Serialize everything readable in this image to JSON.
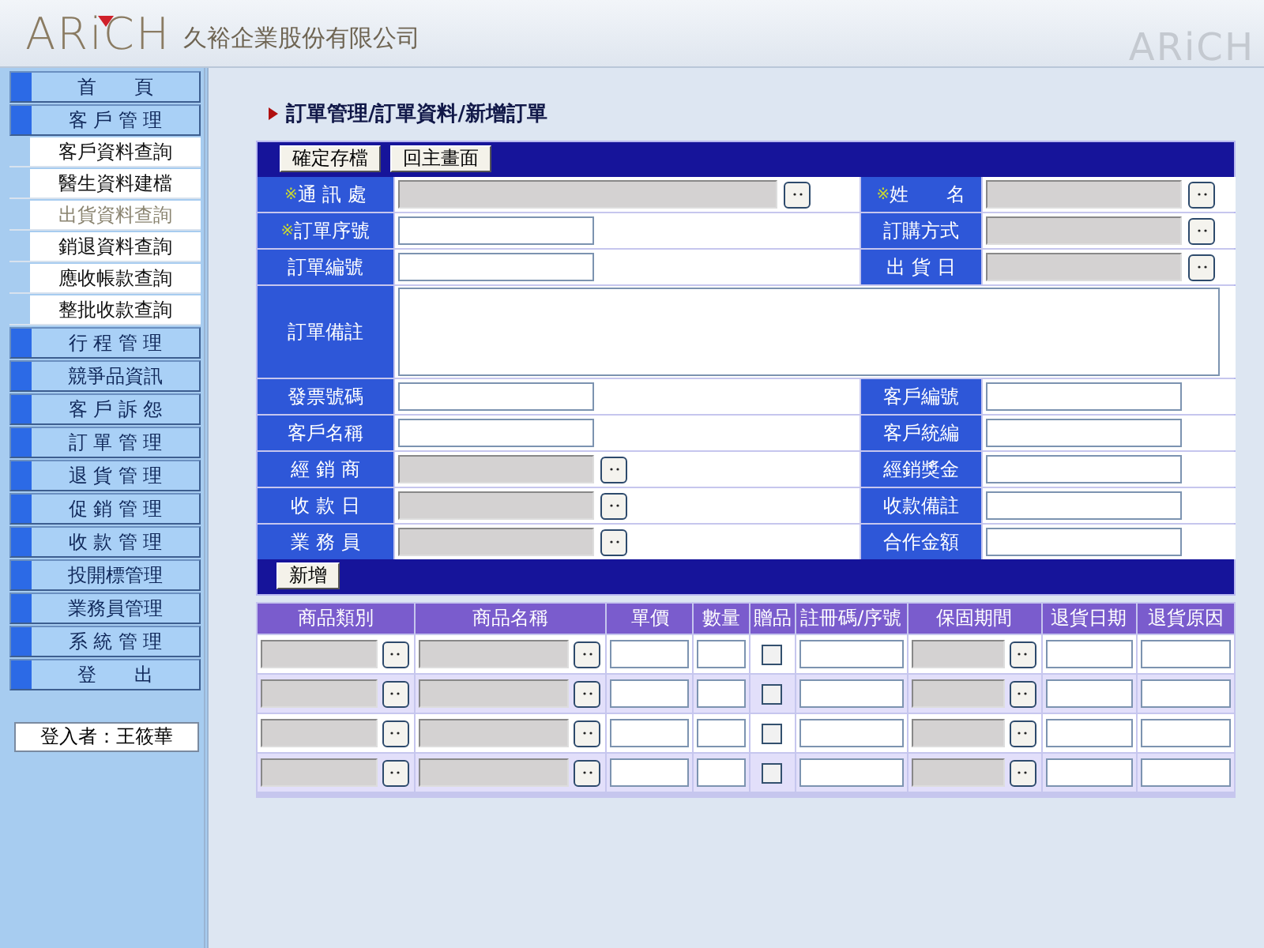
{
  "header": {
    "logo": "ARiCH",
    "company": "久裕企業股份有限公司",
    "corner_logo": "ARiCH"
  },
  "sidebar": {
    "items": [
      {
        "label": "首　　頁",
        "kind": "menu",
        "selected": false
      },
      {
        "label": "客 戶 管 理",
        "kind": "menu",
        "selected": false
      },
      {
        "label": "客戶資料查詢",
        "kind": "submenu",
        "selected": false
      },
      {
        "label": "醫生資料建檔",
        "kind": "submenu",
        "selected": false
      },
      {
        "label": "出貨資料查詢",
        "kind": "submenu",
        "selected": true
      },
      {
        "label": "銷退資料查詢",
        "kind": "submenu",
        "selected": false
      },
      {
        "label": "應收帳款查詢",
        "kind": "submenu",
        "selected": false
      },
      {
        "label": "整批收款查詢",
        "kind": "submenu",
        "selected": false
      },
      {
        "label": "行 程 管 理",
        "kind": "menu",
        "selected": false
      },
      {
        "label": "競爭品資訊",
        "kind": "menu",
        "selected": false
      },
      {
        "label": "客 戶 訴 怨",
        "kind": "menu",
        "selected": false
      },
      {
        "label": "訂 單 管 理",
        "kind": "menu",
        "selected": false
      },
      {
        "label": "退 貨 管 理",
        "kind": "menu",
        "selected": false
      },
      {
        "label": "促 銷 管 理",
        "kind": "menu",
        "selected": false
      },
      {
        "label": "收 款 管 理",
        "kind": "menu",
        "selected": false
      },
      {
        "label": "投開標管理",
        "kind": "menu",
        "selected": false
      },
      {
        "label": "業務員管理",
        "kind": "menu",
        "selected": false
      },
      {
        "label": "系 統 管 理",
        "kind": "menu",
        "selected": false
      },
      {
        "label": "登　　出",
        "kind": "menu",
        "selected": false
      }
    ],
    "login": "登入者：王筱華"
  },
  "breadcrumb": "訂單管理/訂單資料/新增訂單",
  "form": {
    "buttons": [
      "確定存檔",
      "回主畫面"
    ],
    "rows": [
      {
        "left": {
          "mark": "※",
          "label": "通 訊 處",
          "kind": "lookup_wide"
        },
        "right": {
          "mark": "※",
          "label": "姓　　名",
          "kind": "lookup"
        }
      },
      {
        "left": {
          "mark": "※",
          "label": "訂單序號",
          "kind": "text"
        },
        "right": {
          "label": "訂購方式",
          "kind": "lookup"
        }
      },
      {
        "left": {
          "label": "訂單編號",
          "kind": "text"
        },
        "right": {
          "label": "出 貨 日",
          "kind": "lookup"
        }
      },
      {
        "left": {
          "label": "訂單備註",
          "kind": "textarea"
        }
      },
      {
        "left": {
          "label": "發票號碼",
          "kind": "text"
        },
        "right": {
          "label": "客戶編號",
          "kind": "text"
        }
      },
      {
        "left": {
          "label": "客戶名稱",
          "kind": "text"
        },
        "right": {
          "label": "客戶統編",
          "kind": "text"
        }
      },
      {
        "left": {
          "label": "經 銷 商",
          "kind": "lookup"
        },
        "right": {
          "label": "經銷獎金",
          "kind": "text"
        }
      },
      {
        "left": {
          "label": "收 款 日",
          "kind": "lookup"
        },
        "right": {
          "label": "收款備註",
          "kind": "text"
        }
      },
      {
        "left": {
          "label": "業 務 員",
          "kind": "lookup"
        },
        "right": {
          "label": "合作金額",
          "kind": "text"
        }
      }
    ],
    "add_button": "新增"
  },
  "product_table": {
    "columns": [
      {
        "label": "商品類別",
        "kind": "lookup"
      },
      {
        "label": "商品名稱",
        "kind": "lookup"
      },
      {
        "label": "單價",
        "kind": "text"
      },
      {
        "label": "數量",
        "kind": "text"
      },
      {
        "label": "贈品",
        "kind": "checkbox"
      },
      {
        "label": "註冊碼/序號",
        "kind": "text"
      },
      {
        "label": "保固期間",
        "kind": "lookup"
      },
      {
        "label": "退貨日期",
        "kind": "text"
      },
      {
        "label": "退貨原因",
        "kind": "text"
      }
    ],
    "rows": [
      {
        "gift": false
      },
      {
        "gift": false
      },
      {
        "gift": false
      },
      {
        "gift": false
      }
    ]
  }
}
